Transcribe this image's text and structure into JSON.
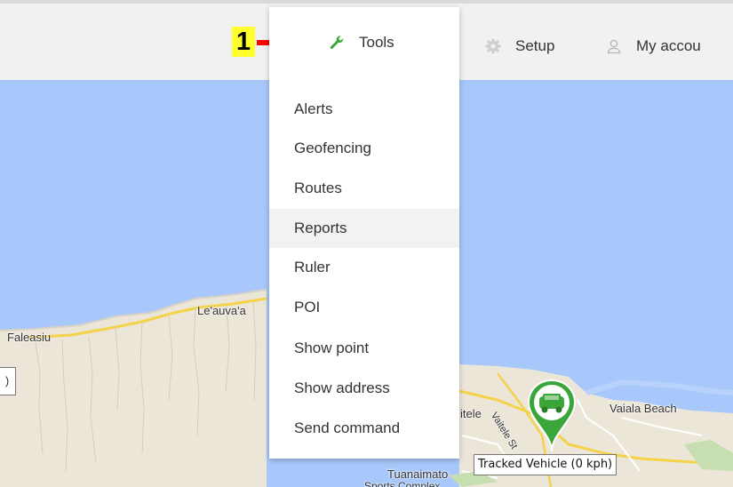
{
  "nav": {
    "tools_label": "Tools",
    "setup_label": "Setup",
    "account_label": "My accou"
  },
  "annotation": {
    "step_number": "1"
  },
  "menu": {
    "items": [
      {
        "label": "Alerts"
      },
      {
        "label": "Geofencing"
      },
      {
        "label": "Routes"
      },
      {
        "label": "Reports"
      },
      {
        "label": "Ruler"
      },
      {
        "label": "POI"
      },
      {
        "label": "Show point"
      },
      {
        "label": "Show address"
      },
      {
        "label": "Send command"
      }
    ],
    "highlighted_index": 3
  },
  "map": {
    "labels": {
      "leauvaa": "Le'auva'a",
      "faleasiu": "Faleasiu",
      "vaiala_beach": "Vaiala Beach",
      "itele": "itele",
      "tuanaimato": "Tuanaimato",
      "sports_complex": "Sports Complex",
      "vaitele_st": "Vaitele St"
    },
    "zoom_label": ")"
  },
  "vehicle": {
    "label": "Tracked Vehicle (0 kph)"
  },
  "colors": {
    "accent_green": "#3aa63a",
    "water": "#a8c8fb",
    "land": "#ece6d9",
    "arrow_red": "#ff0000",
    "annotation_yellow": "#ffff2e"
  }
}
